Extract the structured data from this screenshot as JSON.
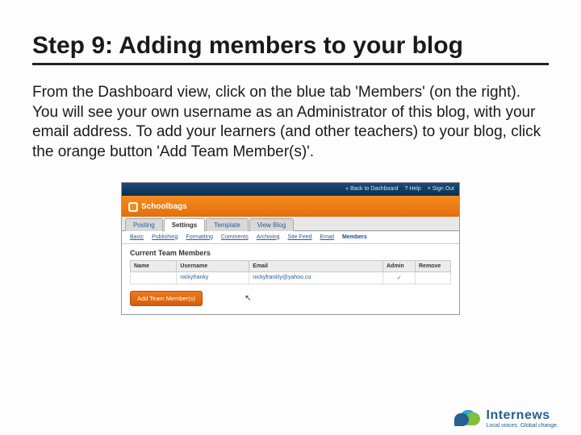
{
  "title": "Step 9: Adding members to your blog",
  "body": "From the Dashboard view, click on the blue tab 'Members' (on the right). You will see your own username as an Administrator of this blog, with your email address. To add your learners (and other teachers) to your blog, click the orange button 'Add Team Member(s)'.",
  "screenshot": {
    "topnav": {
      "back": "« Back to Dashboard",
      "help": "? Help",
      "signout": "× Sign Out"
    },
    "brand": "Schoolbags",
    "tabs": [
      "Posting",
      "Settings",
      "Template",
      "View Blog"
    ],
    "active_tab": "Settings",
    "subnav": [
      "Basic",
      "Publishing",
      "Formatting",
      "Comments",
      "Archiving",
      "Site Feed",
      "Email",
      "Members"
    ],
    "active_subnav": "Members",
    "section_heading": "Current Team Members",
    "table": {
      "headers": [
        "Name",
        "Username",
        "Email",
        "Admin",
        "Remove"
      ],
      "row": {
        "name": "",
        "username": "nickyfranky",
        "email": "nickyfrankly@yahoo.co",
        "admin": "✓",
        "remove": ""
      }
    },
    "button": "Add Team Member(s)"
  },
  "footer": {
    "brand": "Internews",
    "tagline": "Local voices. Global change."
  }
}
